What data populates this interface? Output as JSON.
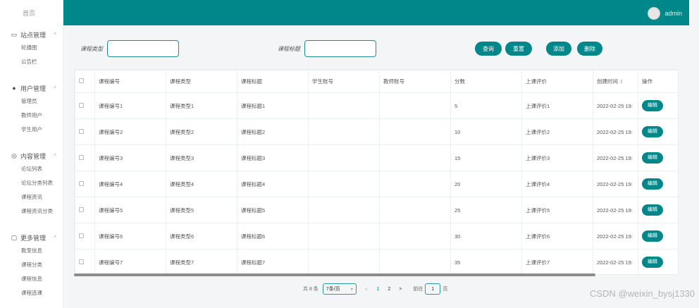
{
  "sidebar": {
    "top_label": "首页",
    "groups": [
      {
        "title": "站点管理",
        "icon": "monitor-icon",
        "items": [
          "轮播图",
          "公告栏"
        ]
      },
      {
        "title": "用户管理",
        "icon": "user-icon",
        "items": [
          "管理员",
          "教师用户",
          "学生用户"
        ]
      },
      {
        "title": "内容管理",
        "icon": "content-icon",
        "items": [
          "论坛列表",
          "论坛分类列表",
          "课程资讯",
          "课程资讯分类"
        ]
      },
      {
        "title": "更多管理",
        "icon": "more-icon",
        "items": [
          "教室信息",
          "课程分类",
          "课程信息",
          "课程选课"
        ]
      }
    ]
  },
  "header": {
    "username": "admin"
  },
  "search": {
    "type_label": "课程类型",
    "type_value": "",
    "title_label": "课程标题",
    "title_value": ""
  },
  "toolbar": {
    "query_label": "查询",
    "reset_label": "重置",
    "add_label": "添加",
    "delete_label": "删除"
  },
  "table": {
    "columns": [
      "课程编号",
      "课程类型",
      "课程标题",
      "学生账号",
      "教师账号",
      "分数",
      "上课评价",
      "创建时间",
      "操作"
    ],
    "edit_label": "编辑",
    "rows": [
      {
        "code": "课程编号1",
        "type": "课程类型1",
        "title": "课程标题1",
        "student": "",
        "teacher": "",
        "score": "5",
        "eval": "上课评价1",
        "created": "2022-02-25 19:"
      },
      {
        "code": "课程编号2",
        "type": "课程类型2",
        "title": "课程标题2",
        "student": "",
        "teacher": "",
        "score": "10",
        "eval": "上课评价2",
        "created": "2022-02-25 19:"
      },
      {
        "code": "课程编号3",
        "type": "课程类型3",
        "title": "课程标题3",
        "student": "",
        "teacher": "",
        "score": "15",
        "eval": "上课评价3",
        "created": "2022-02-25 19:"
      },
      {
        "code": "课程编号4",
        "type": "课程类型4",
        "title": "课程标题4",
        "student": "",
        "teacher": "",
        "score": "20",
        "eval": "上课评价4",
        "created": "2022-02-25 19:"
      },
      {
        "code": "课程编号5",
        "type": "课程类型5",
        "title": "课程标题5",
        "student": "",
        "teacher": "",
        "score": "25",
        "eval": "上课评价5",
        "created": "2022-02-25 19:"
      },
      {
        "code": "课程编号6",
        "type": "课程类型6",
        "title": "课程标题6",
        "student": "",
        "teacher": "",
        "score": "30",
        "eval": "上课评价6",
        "created": "2022-02-25 19:"
      },
      {
        "code": "课程编号7",
        "type": "课程类型7",
        "title": "课程标题7",
        "student": "",
        "teacher": "",
        "score": "35",
        "eval": "上课评价7",
        "created": "2022-02-25 19:"
      }
    ]
  },
  "pagination": {
    "total_label": "共 8 条",
    "page_size": "7条/页",
    "prev": "<",
    "pages": [
      "1",
      "2"
    ],
    "active_page": "1",
    "next": ">",
    "goto_label": "前往",
    "goto_value": "1",
    "page_suffix": "页"
  },
  "watermark": "CSDN @weixin_bysj1330",
  "colors": {
    "accent": "#00878a"
  }
}
